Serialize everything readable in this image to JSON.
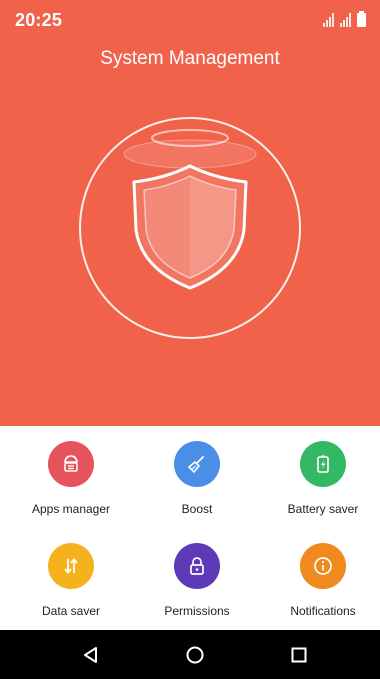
{
  "status_bar": {
    "time": "20:25"
  },
  "header": {
    "title": "System Management"
  },
  "features": [
    {
      "label": "Apps manager",
      "icon": "android-icon",
      "color": "#e5545a"
    },
    {
      "label": "Boost",
      "icon": "broom-icon",
      "color": "#4a8ee8"
    },
    {
      "label": "Battery saver",
      "icon": "battery-icon",
      "color": "#33b866"
    },
    {
      "label": "Data saver",
      "icon": "data-arrows-icon",
      "color": "#f5b21e"
    },
    {
      "label": "Permissions",
      "icon": "lock-icon",
      "color": "#5c3ab8"
    },
    {
      "label": "Notifications",
      "icon": "info-icon",
      "color": "#f08a1e"
    }
  ],
  "nav": {
    "back_icon": "back-triangle-icon",
    "home_icon": "home-circle-icon",
    "recents_icon": "recents-square-icon"
  },
  "colors": {
    "hero_background": "#f0624a",
    "nav_background": "#000000"
  }
}
